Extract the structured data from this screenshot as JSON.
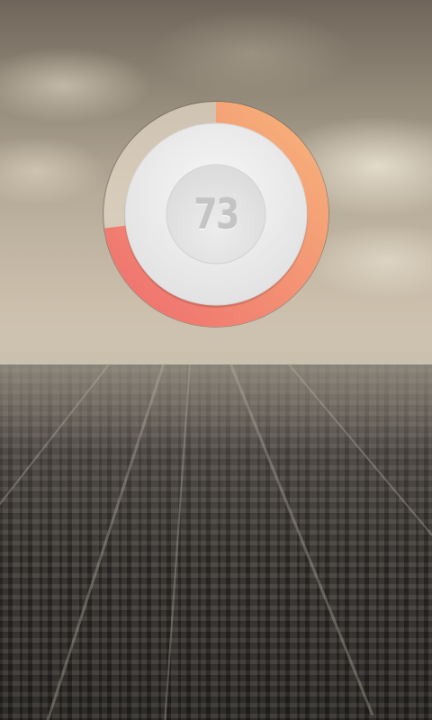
{
  "gauge": {
    "value": "73",
    "level": 0.73,
    "colors": {
      "arc_start": "#ef6f6e",
      "arc_end": "#f7b47a",
      "track": "#d8cbb8",
      "face": "#ececec",
      "inner_face": "#e4e4e4",
      "value_text": "#c4c4c4"
    }
  }
}
